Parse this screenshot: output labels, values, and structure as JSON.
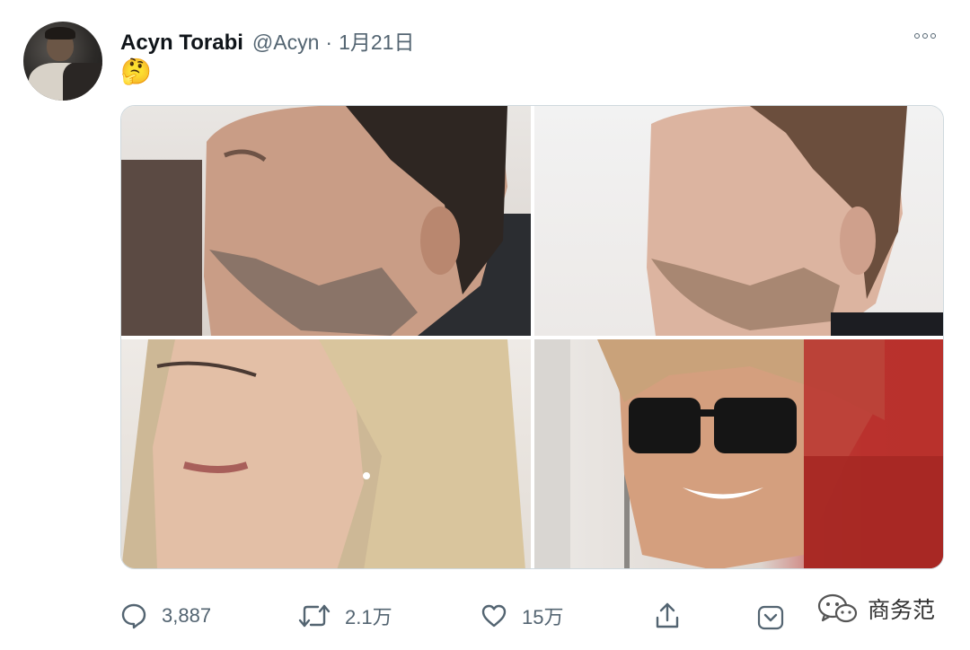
{
  "tweet": {
    "author_name": "Acyn Torabi",
    "author_handle": "@Acyn",
    "separator": "·",
    "date": "1月21日",
    "text": "🤔",
    "avatar_icon": "user-avatar"
  },
  "stats": {
    "replies": "3,887",
    "retweets": "2.1万",
    "likes": "15万"
  },
  "watermark": {
    "label": "商务范"
  },
  "colors": {
    "text_primary": "#0f1419",
    "text_secondary": "#536471",
    "border": "#cfd9de"
  }
}
